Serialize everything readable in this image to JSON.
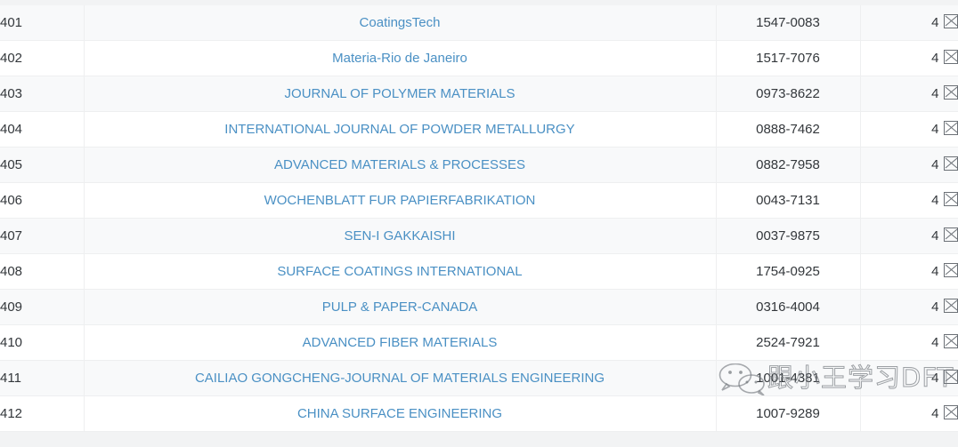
{
  "table": {
    "columns": [
      "rank",
      "journal_name",
      "issn",
      "count"
    ],
    "rows": [
      {
        "rank": "401",
        "name": "CoatingsTech",
        "issn": "1547-0083",
        "count": "4",
        "icon": "broken-image-icon"
      },
      {
        "rank": "402",
        "name": "Materia-Rio de Janeiro",
        "issn": "1517-7076",
        "count": "4",
        "icon": "broken-image-icon"
      },
      {
        "rank": "403",
        "name": "JOURNAL OF POLYMER MATERIALS",
        "issn": "0973-8622",
        "count": "4",
        "icon": "broken-image-icon"
      },
      {
        "rank": "404",
        "name": "INTERNATIONAL JOURNAL OF POWDER METALLURGY",
        "issn": "0888-7462",
        "count": "4",
        "icon": "broken-image-icon"
      },
      {
        "rank": "405",
        "name": "ADVANCED MATERIALS & PROCESSES",
        "issn": "0882-7958",
        "count": "4",
        "icon": "broken-image-icon"
      },
      {
        "rank": "406",
        "name": "WOCHENBLATT FUR PAPIERFABRIKATION",
        "issn": "0043-7131",
        "count": "4",
        "icon": "broken-image-icon"
      },
      {
        "rank": "407",
        "name": "SEN-I GAKKAISHI",
        "issn": "0037-9875",
        "count": "4",
        "icon": "broken-image-icon"
      },
      {
        "rank": "408",
        "name": "SURFACE COATINGS INTERNATIONAL",
        "issn": "1754-0925",
        "count": "4",
        "icon": "broken-image-icon"
      },
      {
        "rank": "409",
        "name": "PULP & PAPER-CANADA",
        "issn": "0316-4004",
        "count": "4",
        "icon": "broken-image-icon"
      },
      {
        "rank": "410",
        "name": "ADVANCED FIBER MATERIALS",
        "issn": "2524-7921",
        "count": "4",
        "icon": "broken-image-icon"
      },
      {
        "rank": "411",
        "name": "CAILIAO GONGCHENG-JOURNAL OF MATERIALS ENGINEERING",
        "issn": "1001-4381",
        "count": "4",
        "icon": "broken-image-icon"
      },
      {
        "rank": "412",
        "name": "CHINA SURFACE ENGINEERING",
        "issn": "1007-9289",
        "count": "4",
        "icon": "broken-image-icon"
      }
    ]
  },
  "watermark": {
    "text": "跟小王学习DFT",
    "logo": "wechat-icon"
  },
  "colors": {
    "link": "#4a90c4",
    "text": "#33373b",
    "row_alt_bg": "#f8f9fa",
    "row_bg": "#ffffff",
    "page_bg": "#f2f3f4",
    "border": "#eeeff0"
  }
}
